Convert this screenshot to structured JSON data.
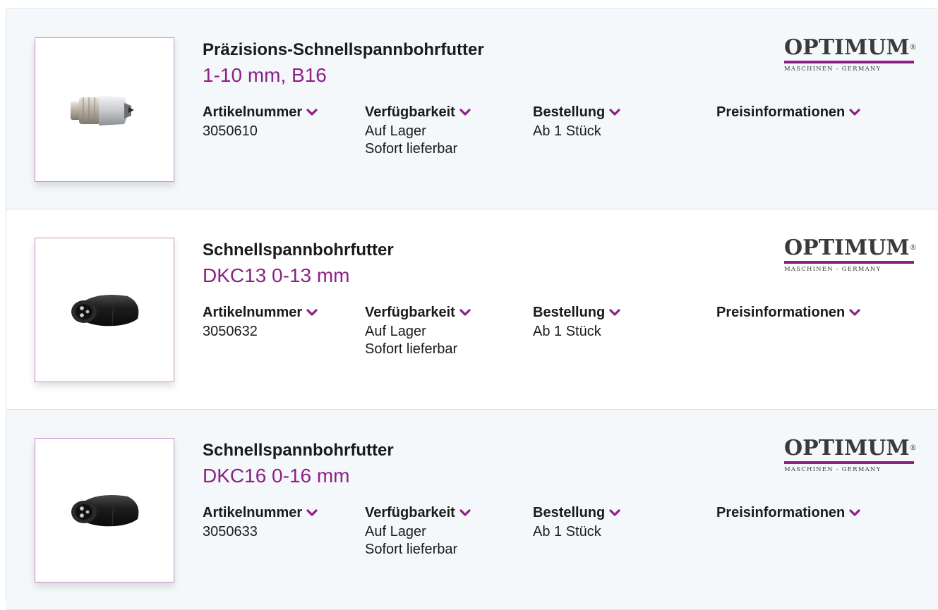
{
  "brand": {
    "name": "OPTIMUM",
    "registered": "®",
    "tagline": "MASCHINEN - GERMANY",
    "accent_color": "#8e1f87"
  },
  "labels": {
    "article_number": "Artikelnummer",
    "availability": "Verfügbarkeit",
    "order": "Bestellung",
    "price_info": "Preisinformationen"
  },
  "products": [
    {
      "title": "Präzisions-Schnellspannbohrfutter",
      "subtitle": "1-10 mm, B16",
      "article_number": "3050610",
      "availability_line1": "Auf Lager",
      "availability_line2": "Sofort lieferbar",
      "order": "Ab 1 Stück",
      "image": "silver-drill-chuck"
    },
    {
      "title": "Schnellspannbohrfutter",
      "subtitle": "DKC13 0-13 mm",
      "article_number": "3050632",
      "availability_line1": "Auf Lager",
      "availability_line2": "Sofort lieferbar",
      "order": "Ab 1 Stück",
      "image": "black-drill-chuck"
    },
    {
      "title": "Schnellspannbohrfutter",
      "subtitle": "DKC16 0-16 mm",
      "article_number": "3050633",
      "availability_line1": "Auf Lager",
      "availability_line2": "Sofort lieferbar",
      "order": "Ab 1 Stück",
      "image": "black-drill-chuck"
    }
  ]
}
